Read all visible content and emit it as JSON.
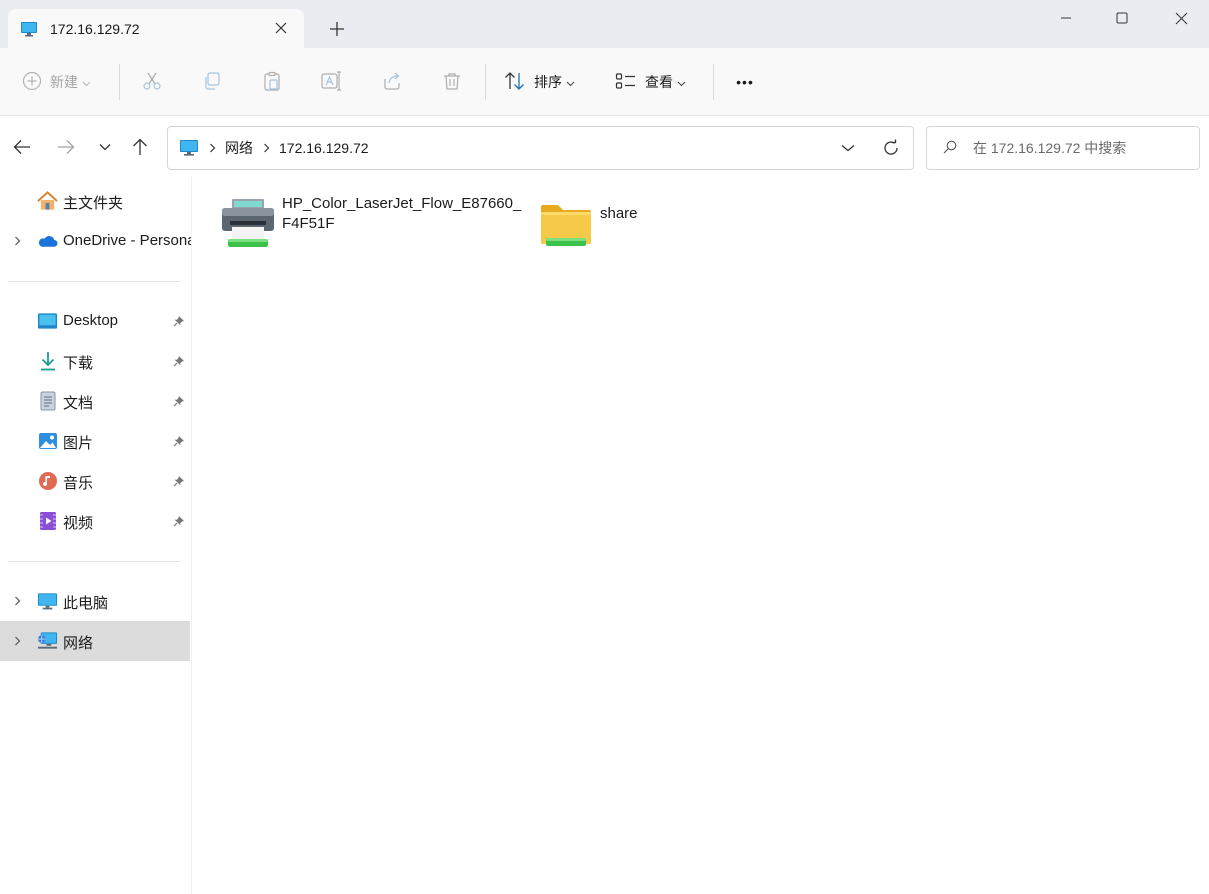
{
  "window": {
    "tab_title": "172.16.129.72",
    "new_tab_symbol": "+"
  },
  "commandbar": {
    "new_label": "新建",
    "sort_label": "排序",
    "view_label": "查看",
    "more_label": "•••"
  },
  "address": {
    "crumbs": [
      "网络",
      "172.16.129.72"
    ]
  },
  "search": {
    "placeholder": "在 172.16.129.72 中搜索"
  },
  "sidebar": {
    "items": [
      {
        "label": "主文件夹"
      },
      {
        "label": "OneDrive - Personal"
      },
      {
        "label": "Desktop"
      },
      {
        "label": "下载"
      },
      {
        "label": "文档"
      },
      {
        "label": "图片"
      },
      {
        "label": "音乐"
      },
      {
        "label": "视频"
      },
      {
        "label": "此电脑"
      },
      {
        "label": "网络"
      }
    ]
  },
  "content": {
    "items": [
      {
        "name": "HP_Color_LaserJet_Flow_E87660_F4F51F",
        "icon": "printer-icon"
      },
      {
        "name": "share",
        "icon": "folder-icon"
      }
    ]
  },
  "colors": {
    "titlebar": "#e9ecf0",
    "commandbar": "#f9f9f9",
    "selected": "#dcdcdc",
    "folder": "#f7c948",
    "share_bar": "#3cc24a"
  }
}
